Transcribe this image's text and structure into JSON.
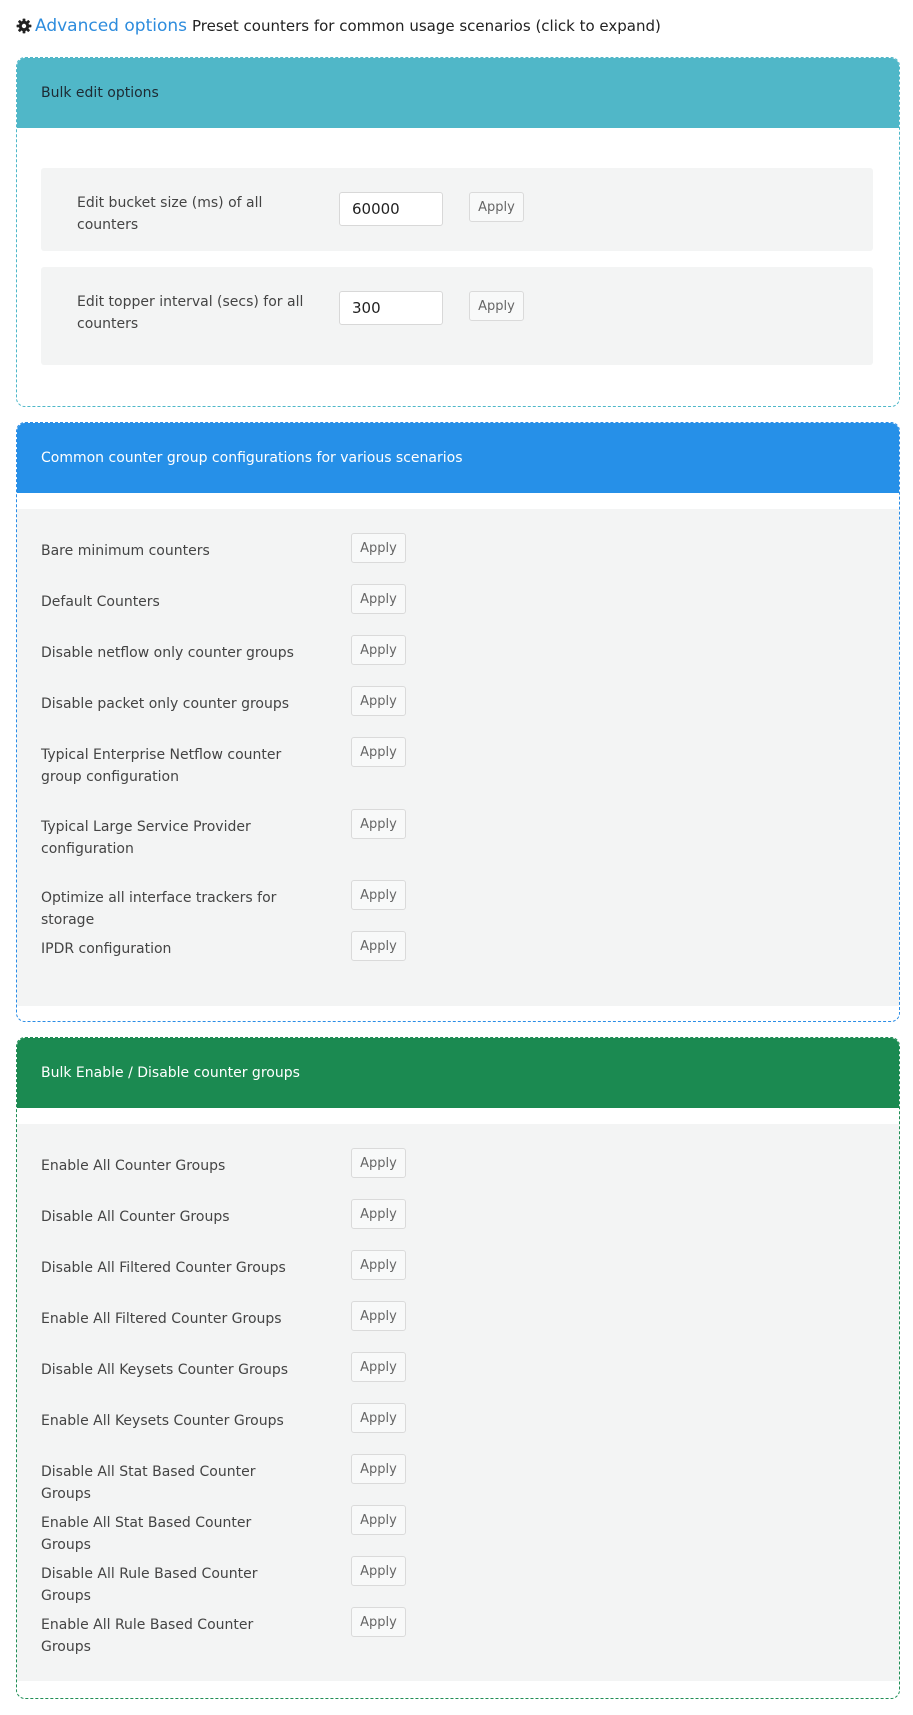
{
  "header": {
    "link": "Advanced options",
    "description": "Preset counters for common usage scenarios (click to expand)"
  },
  "bulk_edit": {
    "title": "Bulk edit options",
    "bucket": {
      "label": "Edit bucket size (ms) of all counters",
      "value": "60000",
      "button": "Apply"
    },
    "topper": {
      "label": "Edit topper interval (secs) for all counters",
      "value": "300",
      "button": "Apply"
    }
  },
  "common": {
    "title": "Common counter group configurations for various scenarios",
    "items": [
      {
        "label": "Bare minimum counters",
        "button": "Apply"
      },
      {
        "label": "Default Counters",
        "button": "Apply"
      },
      {
        "label": "Disable netflow only counter groups",
        "button": "Apply"
      },
      {
        "label": "Disable packet only counter groups",
        "button": "Apply"
      },
      {
        "label": "Typical Enterprise Netflow counter group configuration",
        "button": "Apply"
      },
      {
        "label": "Typical Large Service Provider configuration",
        "button": "Apply"
      },
      {
        "label": "Optimize all interface trackers for storage",
        "button": "Apply"
      },
      {
        "label": "IPDR configuration",
        "button": "Apply"
      }
    ]
  },
  "enable": {
    "title": "Bulk Enable / Disable counter groups",
    "items": [
      {
        "label": "Enable All Counter Groups",
        "button": "Apply"
      },
      {
        "label": "Disable All Counter Groups",
        "button": "Apply"
      },
      {
        "label": "Disable All Filtered Counter Groups",
        "button": "Apply"
      },
      {
        "label": "Enable All Filtered Counter Groups",
        "button": "Apply"
      },
      {
        "label": "Disable All Keysets Counter Groups",
        "button": "Apply"
      },
      {
        "label": "Enable All Keysets Counter Groups",
        "button": "Apply"
      },
      {
        "label": "Disable All Stat Based Counter Groups",
        "button": "Apply"
      },
      {
        "label": "Enable All Stat Based Counter Groups",
        "button": "Apply"
      },
      {
        "label": "Disable All Rule Based Counter Groups",
        "button": "Apply"
      },
      {
        "label": "Enable All Rule Based Counter Groups",
        "button": "Apply"
      }
    ]
  },
  "colors": {
    "link": "#2d8cdd",
    "bulk_edit_header": "#50b7c8",
    "common_header": "#2690e8",
    "enable_header": "#1b8a51",
    "row_background": "#f3f4f4"
  },
  "icons": {
    "header": "gear-icon"
  }
}
